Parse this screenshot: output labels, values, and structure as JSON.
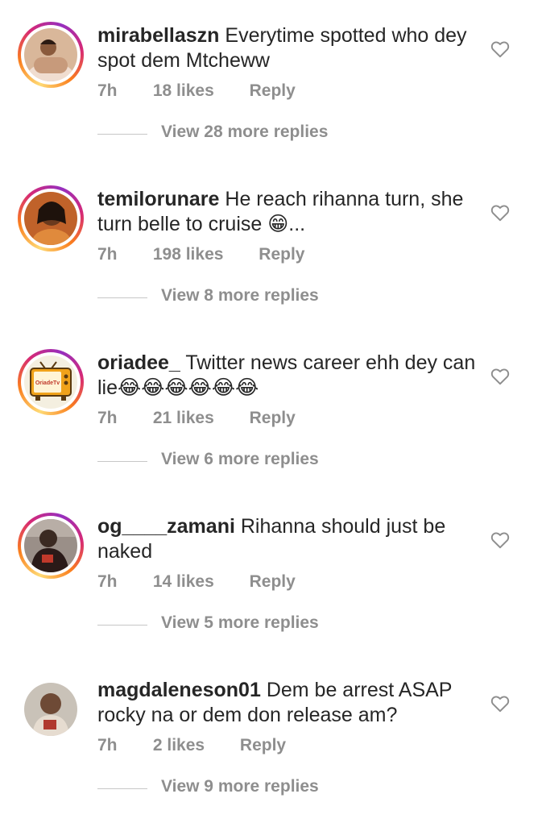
{
  "comments": [
    {
      "username": "mirabellaszn",
      "text": "Everytime spotted who dey spot dem Mtcheww",
      "time": "7h",
      "likes": "18 likes",
      "reply": "Reply",
      "view_replies": "View 28 more replies",
      "avatar_ring": true
    },
    {
      "username": "temilorunare",
      "text": "He reach rihanna turn, she turn belle to cruise 😁...",
      "time": "7h",
      "likes": "198 likes",
      "reply": "Reply",
      "view_replies": "View 8 more replies",
      "avatar_ring": true
    },
    {
      "username": "oriadee_",
      "text": "Twitter news career ehh dey can lie😂😂😂😂😂😂",
      "time": "7h",
      "likes": "21 likes",
      "reply": "Reply",
      "view_replies": "View 6 more replies",
      "avatar_ring": true,
      "avatar_text": "OriadeTv"
    },
    {
      "username": "og____zamani",
      "text": "Rihanna should just be naked",
      "time": "7h",
      "likes": "14 likes",
      "reply": "Reply",
      "view_replies": "View 5 more replies",
      "avatar_ring": true
    },
    {
      "username": "magdaleneson01",
      "text": "Dem be arrest ASAP rocky na or dem don release am?",
      "time": "7h",
      "likes": "2 likes",
      "reply": "Reply",
      "view_replies": "View 9 more replies",
      "avatar_ring": false
    }
  ],
  "icons": {
    "like": "heart-outline-icon"
  },
  "colors": {
    "text": "#262626",
    "secondary": "#8e8e8e",
    "divider": "#c7c7c7"
  }
}
